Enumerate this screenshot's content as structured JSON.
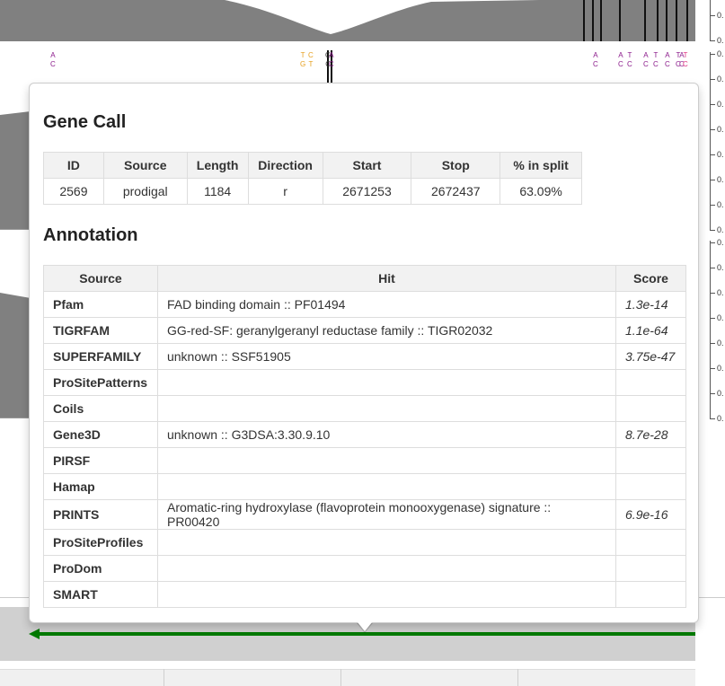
{
  "coverage": {
    "fill_color": "#808080",
    "axis_labels": [
      "0.",
      "0.",
      "0.",
      "0.",
      "0.",
      "0.",
      "0.",
      "0.",
      "0.",
      "0.",
      "0.",
      "0.",
      "0.",
      "0.",
      "0.",
      "0.",
      "0.",
      "0.",
      "0.",
      "0."
    ]
  },
  "snvs": [
    {
      "top": "A",
      "bottom": "C",
      "color": "#8b1a8b"
    },
    {
      "top": "T",
      "bottom": "G",
      "color": "#e6a020"
    },
    {
      "top": "C",
      "bottom": "T",
      "color": "#e6a020"
    },
    {
      "top": "G",
      "bottom": "C",
      "color": "#333333"
    },
    {
      "top": "A",
      "bottom": "C",
      "color": "#8b1a8b"
    },
    {
      "top": "A",
      "bottom": "C",
      "color": "#8b1a8b"
    },
    {
      "top": "A",
      "bottom": "C",
      "color": "#8b1a8b"
    },
    {
      "top": "T",
      "bottom": "C",
      "color": "#8b1a8b"
    },
    {
      "top": "A",
      "bottom": "C",
      "color": "#8b1a8b"
    },
    {
      "top": "T",
      "bottom": "C",
      "color": "#8b1a8b"
    },
    {
      "top": "A",
      "bottom": "C",
      "color": "#8b1a8b"
    },
    {
      "top": "T",
      "bottom": "C",
      "color": "#8b1a8b"
    },
    {
      "top": "A",
      "bottom": "C",
      "color": "#8b1a8b"
    },
    {
      "top": "T",
      "bottom": "C",
      "color": "#e03080"
    }
  ],
  "gene_arrow_color": "#007a00",
  "popover": {
    "gene_call_title": "Gene Call",
    "gene_call": {
      "headers": [
        "ID",
        "Source",
        "Length",
        "Direction",
        "Start",
        "Stop",
        "% in split"
      ],
      "row": [
        "2569",
        "prodigal",
        "1184",
        "r",
        "2671253",
        "2672437",
        "63.09%"
      ]
    },
    "annotation_title": "Annotation",
    "annotation": {
      "headers": [
        "Source",
        "Hit",
        "Score"
      ],
      "rows": [
        {
          "source": "Pfam",
          "hit": "FAD binding domain :: PF01494",
          "score": "1.3e-14"
        },
        {
          "source": "TIGRFAM",
          "hit": "GG-red-SF: geranylgeranyl reductase family :: TIGR02032",
          "score": "1.1e-64"
        },
        {
          "source": "SUPERFAMILY",
          "hit": "unknown :: SSF51905",
          "score": "3.75e-47"
        },
        {
          "source": "ProSitePatterns",
          "hit": "",
          "score": ""
        },
        {
          "source": "Coils",
          "hit": "",
          "score": ""
        },
        {
          "source": "Gene3D",
          "hit": "unknown :: G3DSA:3.30.9.10",
          "score": "8.7e-28"
        },
        {
          "source": "PIRSF",
          "hit": "",
          "score": ""
        },
        {
          "source": "Hamap",
          "hit": "",
          "score": ""
        },
        {
          "source": "PRINTS",
          "hit": "Aromatic-ring hydroxylase (flavoprotein monooxygenase) signature :: PR00420",
          "score": "6.9e-16"
        },
        {
          "source": "ProSiteProfiles",
          "hit": "",
          "score": ""
        },
        {
          "source": "ProDom",
          "hit": "",
          "score": ""
        },
        {
          "source": "SMART",
          "hit": "",
          "score": ""
        }
      ]
    }
  }
}
